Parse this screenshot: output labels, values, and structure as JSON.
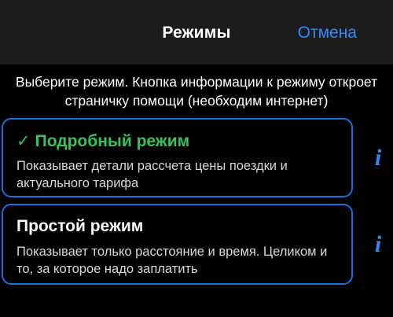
{
  "header": {
    "title": "Режимы",
    "cancel_label": "Отмена"
  },
  "description": "Выберите режим. Кнопка информации к режиму откроет страничку помощи (необходим интернет)",
  "modes": [
    {
      "check": "✓",
      "title": "Подробный режим",
      "description": "Показывает детали рассчета цены поездки и актуального тарифа",
      "selected": true,
      "info_icon": "info-icon",
      "info_label": "i"
    },
    {
      "title": "Простой режим",
      "description": "Показывает только расстояние и время. Целиком и то, за которое надо заплатить",
      "selected": false,
      "info_icon": "info-icon",
      "info_label": "i"
    }
  ],
  "colors": {
    "accent": "#2f8bf3",
    "selected": "#36c35a",
    "card_border": "#1a6fe0",
    "header_bg": "#1c1c1e",
    "background": "#000000"
  }
}
